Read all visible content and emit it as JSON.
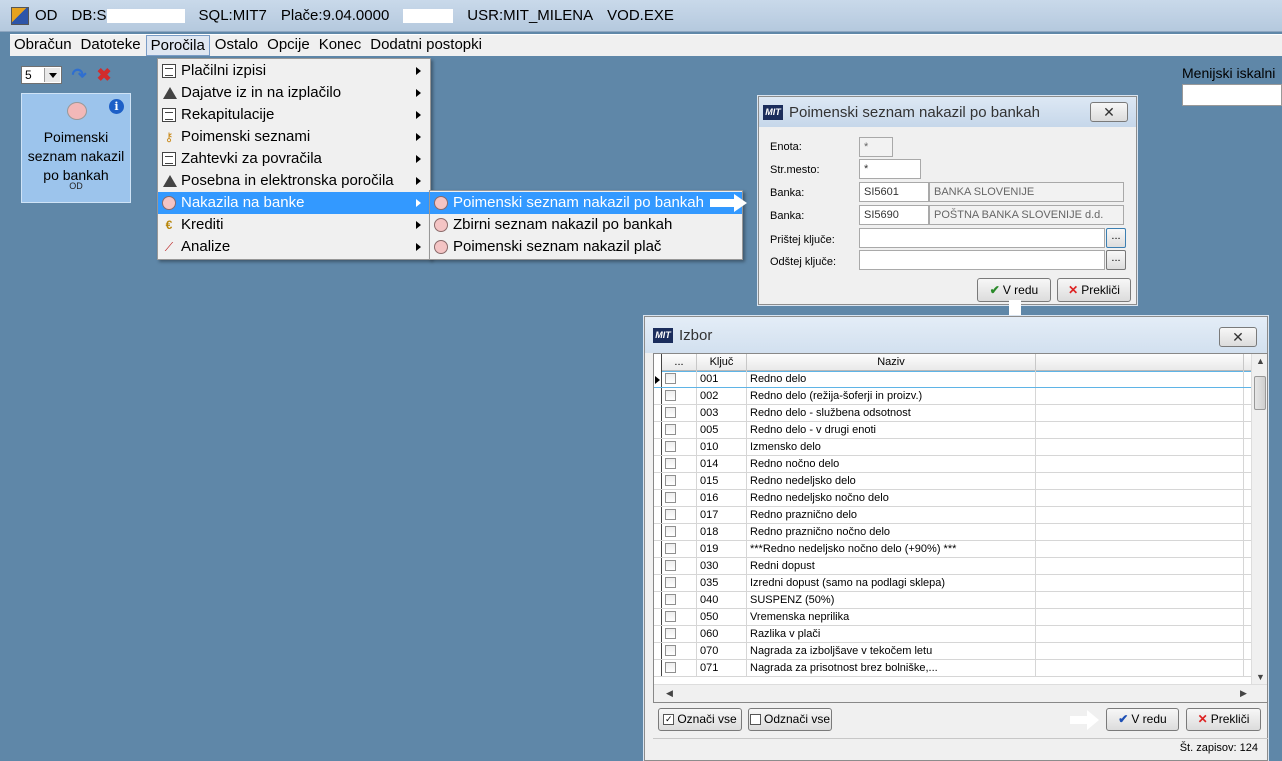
{
  "titlebar": {
    "app": "OD",
    "db": "DB:S",
    "sql": "SQL:MIT7",
    "place": "Plače:9.04.0000",
    "user": "USR:MIT_MILENA",
    "exe": "VOD.EXE"
  },
  "menubar": [
    "Obračun",
    "Datoteke",
    "Poročila",
    "Ostalo",
    "Opcije",
    "Konec",
    "Dodatni postopki"
  ],
  "toolbar": {
    "combo_value": "5"
  },
  "tile": {
    "title": "Poimenski seznam nakazil po bankah",
    "tag": "OD"
  },
  "menu_porocila": [
    {
      "label": "Plačilni  izpisi",
      "icon": "list-icon"
    },
    {
      "label": "Dajatve iz in na izplačilo",
      "icon": "durs-icon"
    },
    {
      "label": "Rekapitulacije",
      "icon": "list-icon"
    },
    {
      "label": "Poimenski seznami",
      "icon": "key-icon"
    },
    {
      "label": "Zahtevki za povračila",
      "icon": "list-icon"
    },
    {
      "label": "Posebna in elektronska poročila",
      "icon": "durs-icon"
    },
    {
      "label": "Nakazila na banke",
      "icon": "piggy-bank-icon"
    },
    {
      "label": "Krediti",
      "icon": "euro-icon"
    },
    {
      "label": "Analize",
      "icon": "chart-icon"
    }
  ],
  "menu_nakazila": [
    "Poimenski seznam nakazil po bankah",
    "Zbirni seznam nakazil po bankah",
    "Poimenski seznam nakazil plač"
  ],
  "menu_search": {
    "label": "Menijski iskalni"
  },
  "dialog1": {
    "title": "Poimenski seznam nakazil po bankah",
    "labels": {
      "enota": "Enota:",
      "strmesto": "Str.mesto:",
      "banka1": "Banka:",
      "banka2": "Banka:",
      "pristej": "Prištej ključe:",
      "odstej": "Odštej ključe:"
    },
    "values": {
      "enota": "*",
      "strmesto": "*",
      "banka1_code": "SI5601",
      "banka1_name": "BANKA SLOVENIJE",
      "banka2_code": "SI5690",
      "banka2_name": "POŠTNA BANKA SLOVENIJE d.d.",
      "pristej": "",
      "odstej": ""
    },
    "dots": "...",
    "ok": "V redu",
    "cancel": "Prekliči"
  },
  "dialog2": {
    "title": "Izbor",
    "columns": {
      "sel": "...",
      "key": "Ključ",
      "name": "Naziv"
    },
    "rows": [
      {
        "key": "001",
        "name": "Redno delo"
      },
      {
        "key": "002",
        "name": "Redno delo (režija-šoferji in proizv.)"
      },
      {
        "key": "003",
        "name": "Redno delo - službena odsotnost"
      },
      {
        "key": "005",
        "name": "Redno delo - v drugi enoti"
      },
      {
        "key": "010",
        "name": "Izmensko delo"
      },
      {
        "key": "014",
        "name": "Redno nočno delo"
      },
      {
        "key": "015",
        "name": "Redno nedeljsko delo"
      },
      {
        "key": "016",
        "name": "Redno nedeljsko nočno delo"
      },
      {
        "key": "017",
        "name": "Redno praznično delo"
      },
      {
        "key": "018",
        "name": "Redno praznično nočno delo"
      },
      {
        "key": "019",
        "name": "***Redno nedeljsko nočno delo (+90%) ***"
      },
      {
        "key": "030",
        "name": "Redni dopust"
      },
      {
        "key": "035",
        "name": "Izredni dopust (samo na podlagi sklepa)"
      },
      {
        "key": "040",
        "name": "SUSPENZ (50%)"
      },
      {
        "key": "050",
        "name": "Vremenska neprilika"
      },
      {
        "key": "060",
        "name": "Razlika v plači"
      },
      {
        "key": "070",
        "name": "Nagrada za izboljšave v tekočem letu"
      },
      {
        "key": "071",
        "name": "Nagrada za prisotnost brez bolniške,..."
      }
    ],
    "select_all": "Označi vse",
    "deselect_all": "Odznači vse",
    "ok": "V redu",
    "cancel": "Prekliči",
    "status": "Št. zapisov: 124"
  },
  "colors": {
    "desktop": "#5f87a8",
    "highlight": "#3399ff",
    "tile": "#9cc4ec"
  }
}
